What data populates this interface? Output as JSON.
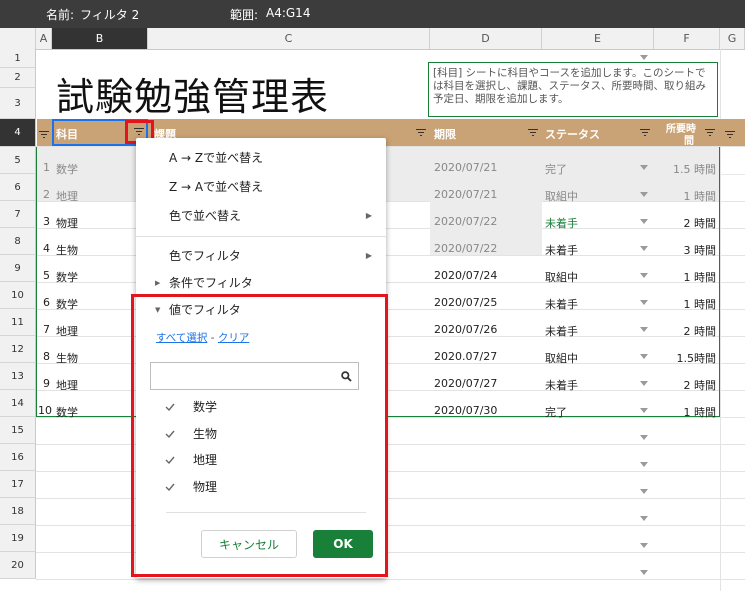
{
  "filterbar": {
    "name_label": "名前:",
    "name_value": "フィルタ 2",
    "range_label": "範囲:",
    "range_value": "A4:G14"
  },
  "columns": [
    "A",
    "B",
    "C",
    "D",
    "E",
    "F",
    "G"
  ],
  "rows": [
    "1",
    "2",
    "3",
    "4",
    "5",
    "6",
    "7",
    "8",
    "9",
    "10",
    "11",
    "12",
    "13",
    "14",
    "15",
    "16",
    "17",
    "18",
    "19",
    "20"
  ],
  "title": "試験勉強管理表",
  "note": [
    "[科目] シートに科目やコースを追加します。このシートで",
    "は科目を選択し、課題、ステータス、所要時間、取り組み",
    "予定日、期限を追加します。"
  ],
  "header": {
    "subject": "科目",
    "task": "課題",
    "deadline": "期限",
    "status": "ステータス",
    "time_line1": "所要時",
    "time_line2": "間"
  },
  "data": [
    {
      "n": "1",
      "subject": "数学",
      "deadline": "2020/07/21",
      "status": "完了",
      "time": "1.5 時間"
    },
    {
      "n": "2",
      "subject": "地理",
      "deadline": "2020/07/21",
      "status": "取組中",
      "time": "1 時間"
    },
    {
      "n": "3",
      "subject": "物理",
      "deadline": "2020/07/22",
      "status": "未着手",
      "time": "2 時間"
    },
    {
      "n": "4",
      "subject": "生物",
      "deadline": "2020/07/22",
      "status": "未着手",
      "time": "3 時間"
    },
    {
      "n": "5",
      "subject": "数学",
      "deadline": "2020/07/24",
      "status": "取組中",
      "time": "1 時間"
    },
    {
      "n": "6",
      "subject": "数学",
      "deadline": "2020/07/25",
      "status": "未着手",
      "time": "1 時間"
    },
    {
      "n": "7",
      "subject": "地理",
      "deadline": "2020/07/26",
      "status": "未着手",
      "time": "2 時間"
    },
    {
      "n": "8",
      "subject": "生物",
      "deadline": "2020.07/27",
      "status": "取組中",
      "time": "1.5時間"
    },
    {
      "n": "9",
      "subject": "地理",
      "deadline": "2020/07/27",
      "status": "未着手",
      "time": "2 時間"
    },
    {
      "n": "10",
      "subject": "数学",
      "deadline": "2020/07/30",
      "status": "完了",
      "time": "1 時間"
    }
  ],
  "menu": {
    "sort_az": "A → Zで並べ替え",
    "sort_za": "Z → Aで並べ替え",
    "sort_color": "色で並べ替え",
    "filter_color": "色でフィルタ",
    "filter_condition": "条件でフィルタ",
    "filter_value": "値でフィルタ",
    "select_all": "すべて選択",
    "dash": " - ",
    "clear": "クリア",
    "values": [
      "数学",
      "生物",
      "地理",
      "物理"
    ],
    "cancel": "キャンセル",
    "ok": "OK"
  },
  "colors": {
    "header_bg": "#c9a275",
    "accent_green": "#188038",
    "link_blue": "#1a73e8",
    "highlight_red": "#e3141e",
    "row_gray": "#ececec"
  }
}
